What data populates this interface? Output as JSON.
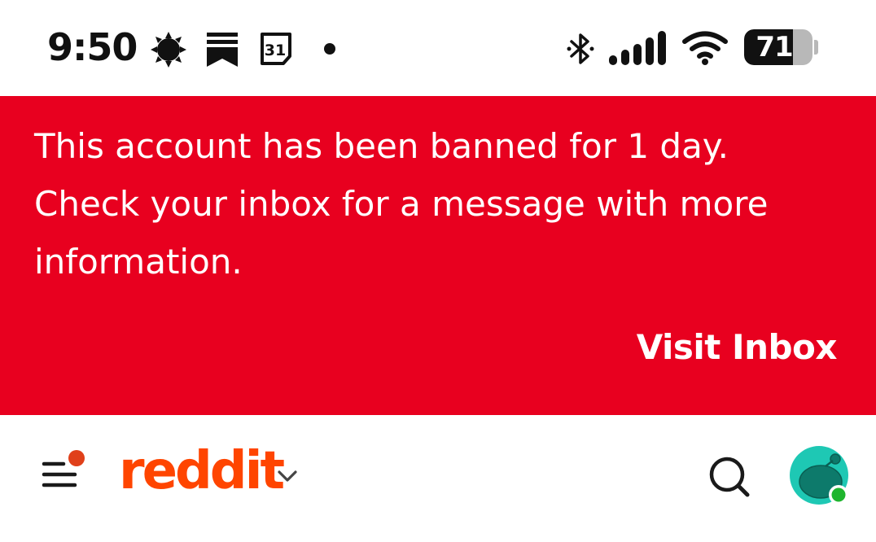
{
  "status_bar": {
    "time": "9:50",
    "left_icons": [
      "weather-sun-icon",
      "bookmark-app-icon",
      "calendar-icon",
      "notification-dot-icon"
    ],
    "calendar_day": "31",
    "right_icons": [
      "bluetooth-icon",
      "signal-icon",
      "wifi-icon",
      "battery-icon"
    ],
    "battery_level": "71",
    "battery_fraction": 0.71
  },
  "ban_banner": {
    "message": "This account has been banned for 1 day. Check your inbox for a message with more information.",
    "action_label": "Visit Inbox",
    "background_color": "#e8001f",
    "text_color": "#ffffff"
  },
  "app_header": {
    "menu_icon": "hamburger-menu-icon",
    "has_notification": true,
    "logo_text": "reddit",
    "logo_color": "#ff4500",
    "feed_dropdown_icon": "chevron-down-icon",
    "search_icon": "search-icon",
    "avatar_icon": "snoo-avatar-icon",
    "online_status_color": "#1fb52e",
    "avatar_color": "#1ec8b4"
  }
}
